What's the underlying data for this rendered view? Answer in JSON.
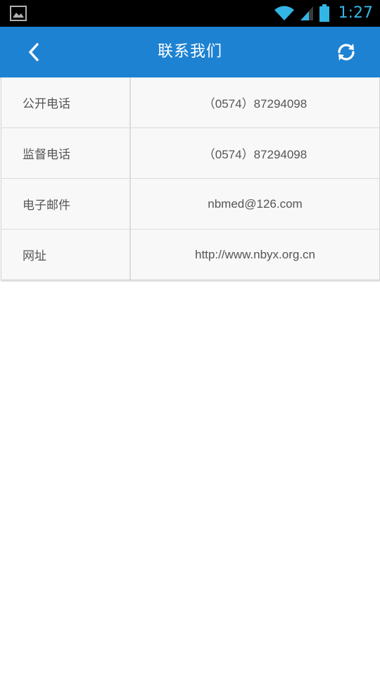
{
  "status_bar": {
    "time": "1:27",
    "icons": [
      "image-notification-icon",
      "wifi-icon",
      "cell-signal-icon",
      "battery-icon"
    ],
    "accent_color": "#33b5e5"
  },
  "app_bar": {
    "title": "联系我们",
    "background_color": "#1e82d2",
    "back_icon": "chevron-left-icon",
    "refresh_icon": "refresh-icon"
  },
  "contacts": [
    {
      "label": "公开电话",
      "value": "（0574）87294098"
    },
    {
      "label": "监督电话",
      "value": "（0574）87294098"
    },
    {
      "label": "电子邮件",
      "value": "nbmed@126.com"
    },
    {
      "label": "网址",
      "value": "http://www.nbyx.org.cn"
    }
  ]
}
